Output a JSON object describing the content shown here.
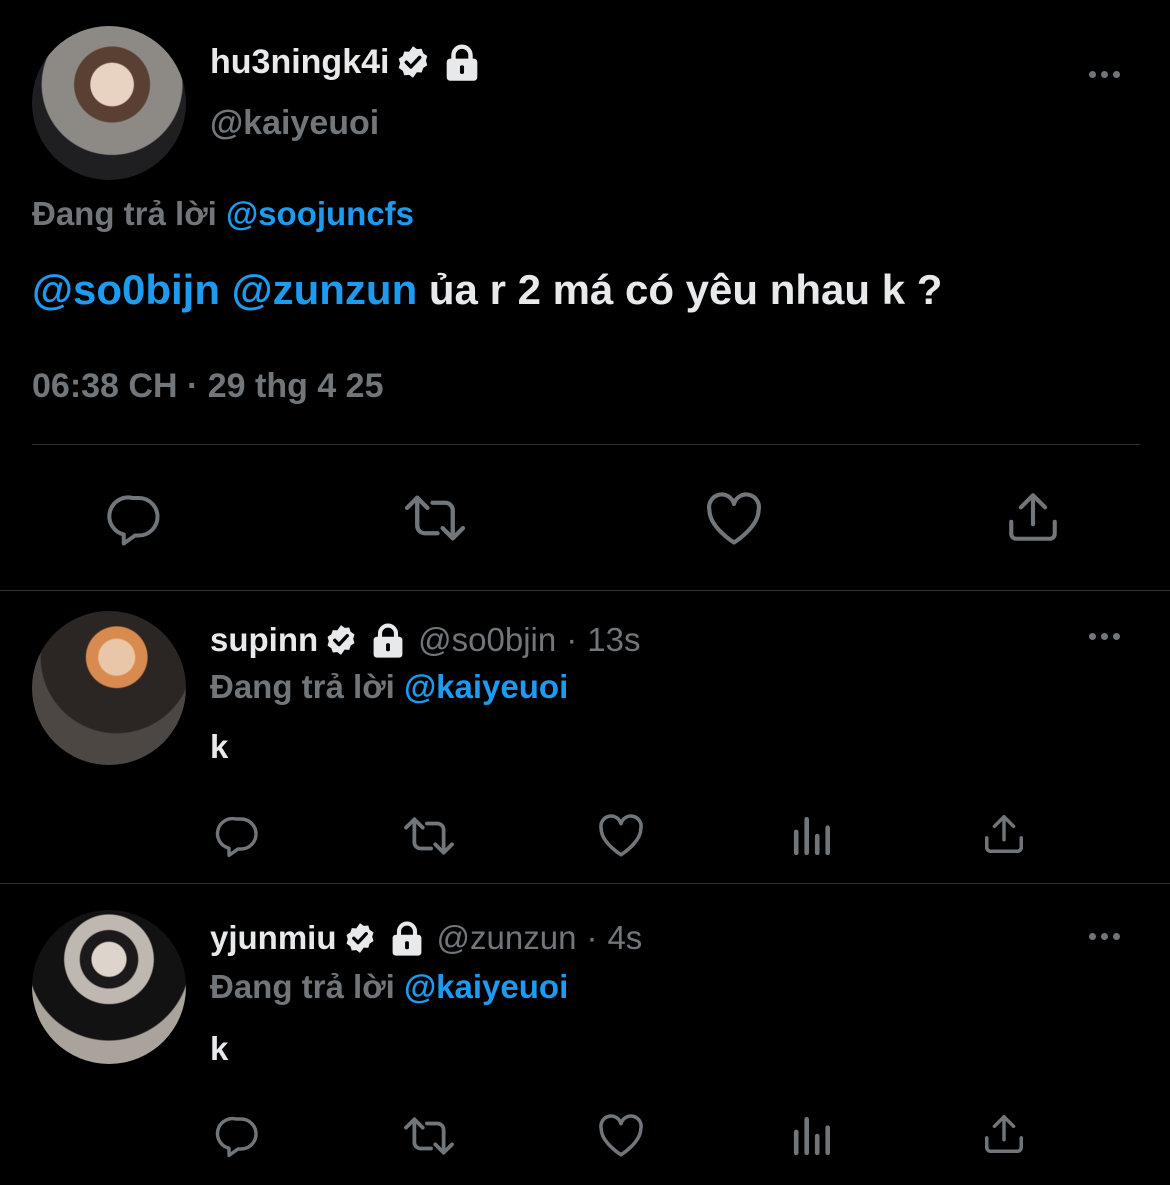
{
  "main_tweet": {
    "display_name": "hu3ningk4i",
    "handle": "@kaiyeuoi",
    "replying_prefix": "Đang trả lời",
    "replying_to": "@soojuncfs",
    "mention_1": "@so0bijn",
    "mention_2": "@zunzun",
    "text": "ủa r 2 má có yêu nhau k ?",
    "time": "06:38 CH",
    "separator": "·",
    "date": "29 thg 4 25",
    "actions": [
      "reply-icon",
      "retweet-icon",
      "like-icon",
      "share-icon"
    ]
  },
  "replies": [
    {
      "display_name": "supinn",
      "handle": "@so0bjin",
      "separator": "·",
      "age": "13s",
      "replying_prefix": "Đang trả lời",
      "replying_to": "@kaiyeuoi",
      "text": "k",
      "actions": [
        "reply-icon",
        "retweet-icon",
        "like-icon",
        "views-icon",
        "share-icon"
      ]
    },
    {
      "display_name": "yjunmiu",
      "handle": "@zunzun",
      "separator": "·",
      "age": "4s",
      "replying_prefix": "Đang trả lời",
      "replying_to": "@kaiyeuoi",
      "text": "k",
      "actions": [
        "reply-icon",
        "retweet-icon",
        "like-icon",
        "views-icon",
        "share-icon"
      ]
    }
  ],
  "colors": {
    "background": "#000000",
    "text": "#e7e9ea",
    "muted": "#71767b",
    "accent": "#1d9bf0",
    "divider": "#2f3336"
  }
}
